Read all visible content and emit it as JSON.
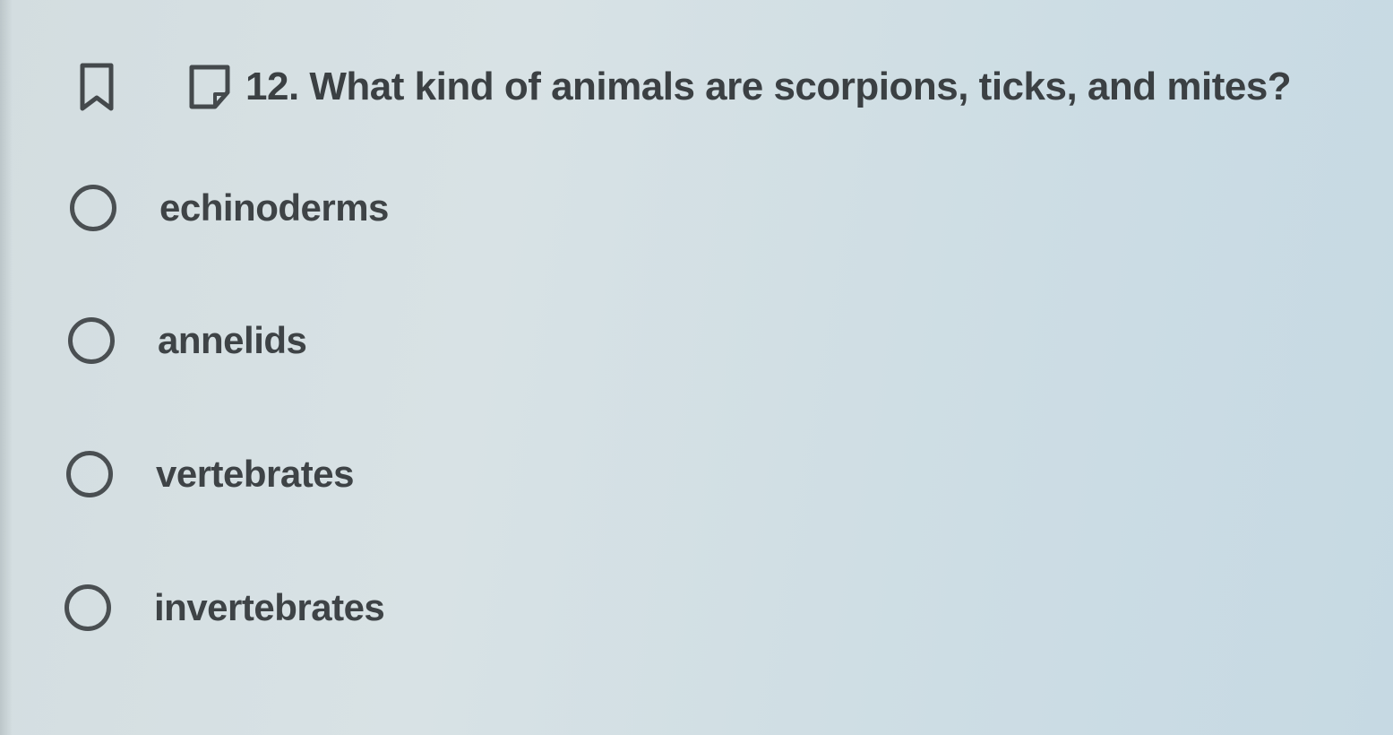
{
  "question": {
    "text": "12. What kind of animals are scorpions, ticks, and mites?",
    "bookmark_icon": "bookmark-icon",
    "note_icon": "note-icon"
  },
  "options": [
    {
      "label": "echinoderms",
      "selected": false
    },
    {
      "label": "annelids",
      "selected": false
    },
    {
      "label": "vertebrates",
      "selected": false
    },
    {
      "label": "invertebrates",
      "selected": false
    }
  ]
}
